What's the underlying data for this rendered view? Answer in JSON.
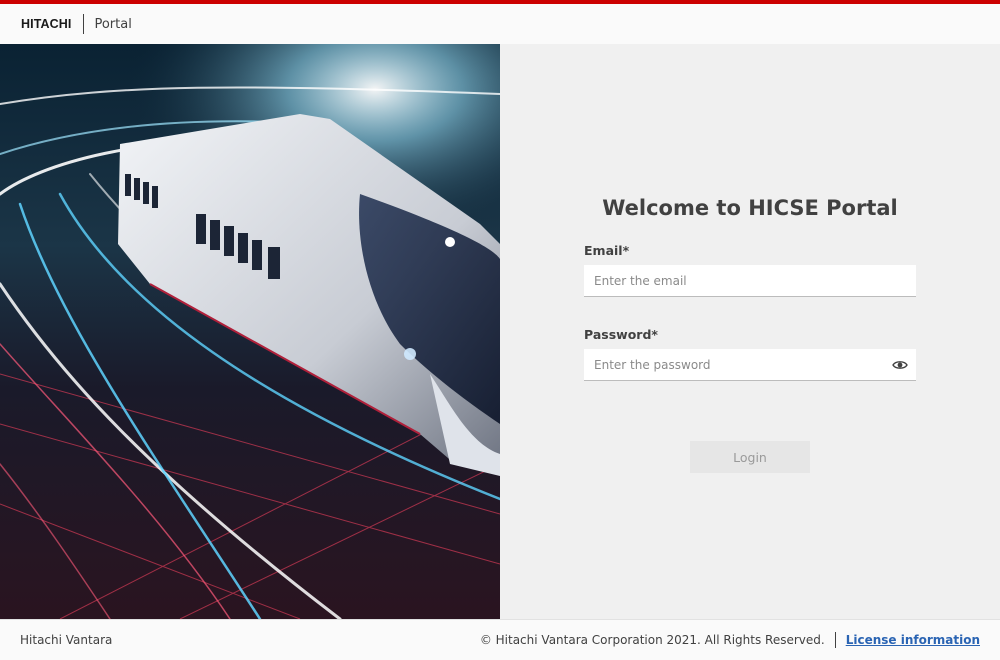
{
  "header": {
    "logo_text": "HITACHI",
    "app_name": "Portal",
    "accent_color": "#cc0000"
  },
  "hero": {
    "image": "high-speed-train-with-light-trails",
    "theme_colors": [
      "#0d1420",
      "#5fd4ff",
      "#e0304a",
      "#ffffff"
    ]
  },
  "login": {
    "title": "Welcome to HICSE Portal",
    "email_label": "Email*",
    "email_placeholder": "Enter the email",
    "email_value": "",
    "password_label": "Password*",
    "password_placeholder": "Enter the password",
    "password_value": "",
    "show_password_icon": "eye-icon",
    "login_button": "Login"
  },
  "footer": {
    "company": "Hitachi Vantara",
    "copyright": "© Hitachi Vantara Corporation 2021. All Rights Reserved.",
    "license_link": "License information",
    "link_color": "#2a64b3"
  }
}
